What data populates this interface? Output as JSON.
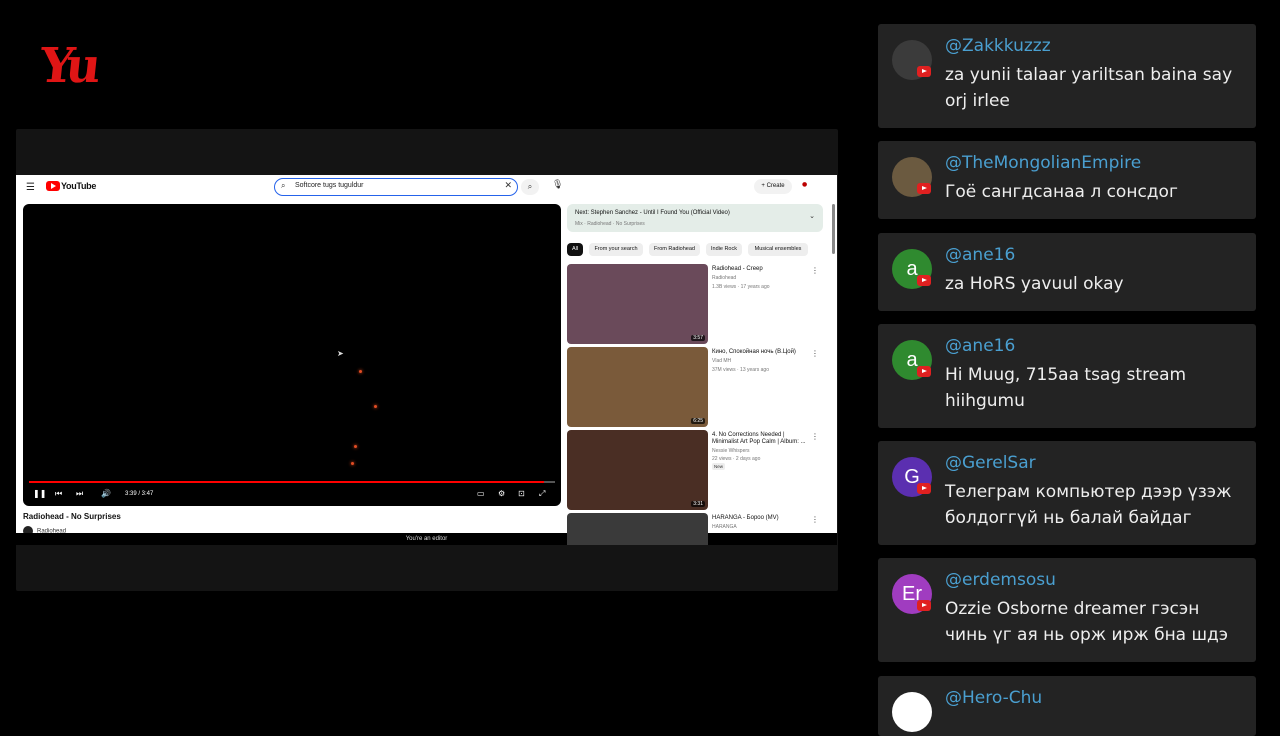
{
  "logo": {
    "text": "Yu"
  },
  "youtube": {
    "brand": "YouTube",
    "search_query": "Softcore tugs tuguldur",
    "create_label": "Create",
    "video_title": "Radiohead - No Surprises",
    "channel": "Radiohead",
    "time": "3:39 / 3:47",
    "progress": 0.98,
    "editor_banner": "You're an editor",
    "next_up": {
      "title": "Next: Stephen Sanchez - Until I Found You (Official Video)",
      "subtitle": "Mix · Radiohead · No Surprises"
    },
    "chips": [
      "All",
      "From your search",
      "From Radiohead",
      "Indie Rock",
      "Musical ensembles"
    ],
    "recommendations": [
      {
        "title": "Radiohead - Creep",
        "channel": "Radiohead",
        "meta": "1.3B views · 17 years ago",
        "duration": "3:57",
        "color": "#6a4a5a"
      },
      {
        "title": "Кино, Спокойная ночь (В.Цой)",
        "channel": "Vlad MH",
        "meta": "37M views · 13 years ago",
        "duration": "6:25",
        "color": "#7a5a3a"
      },
      {
        "title": "4. No Corrections Needed | Minimalist Art Pop Calm | Album: ...",
        "channel": "Nessie Whispers",
        "meta": "22 views · 2 days ago",
        "duration": "3:31",
        "color": "#4a2e24"
      },
      {
        "title": "HARANGA - Бороо (MV)",
        "channel": "HARANGA",
        "meta": "",
        "duration": "",
        "color": "#3a3a3a"
      }
    ]
  },
  "chat": [
    {
      "user": "@Zakkkuzzz",
      "message": "za yunii talaar yariltsan baina say orj irlee",
      "avatar": "",
      "avatar_color": "#3b3b3b"
    },
    {
      "user": "@TheMongolianEmpire",
      "message": "Гоё сангдсанаа л сонсдог",
      "avatar": "",
      "avatar_color": "#6b5a40"
    },
    {
      "user": "@ane16",
      "message": "za HoRS yavuul okay",
      "avatar": "a",
      "avatar_color": "#2f8a2f"
    },
    {
      "user": "@ane16",
      "message": "Hi Muug, 715aa tsag stream hiihgumu",
      "avatar": "a",
      "avatar_color": "#2f8a2f"
    },
    {
      "user": "@GerelSar",
      "message": "Телеграм компьютер дээр үзэж болдоггүй нь балай байдаг",
      "avatar": "G",
      "avatar_color": "#5b2fb0"
    },
    {
      "user": "@erdemsosu",
      "message": "Ozzie Osborne dreamer гэсэн чинь үг ая нь орж ирж бна шдэ",
      "avatar": "Er",
      "avatar_color": "#a03cc0"
    },
    {
      "user": "@Hero-Chu",
      "message": "",
      "avatar": "",
      "avatar_color": "#ffffff"
    }
  ]
}
